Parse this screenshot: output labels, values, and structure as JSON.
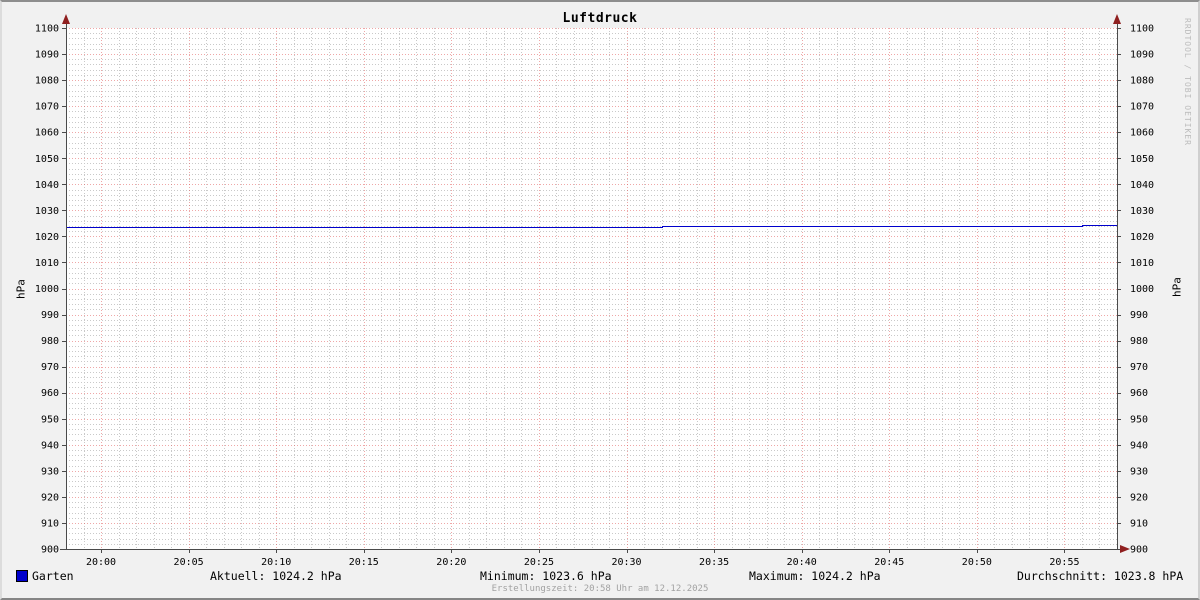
{
  "title": "Luftdruck",
  "watermark": "RRDTOOL / TOBI OETIKER",
  "axis_labels": {
    "left": "hPa",
    "right": "hPa"
  },
  "legend": {
    "series_label": "Garten",
    "aktuell": "Aktuell: 1024.2 hPa",
    "minimum": "Minimum: 1023.6 hPa",
    "maximum": "Maximum: 1024.2 hPa",
    "durchschnitt": "Durchschnitt: 1023.8 hPA"
  },
  "footer": "Erstellungszeit: 20:58 Uhr am 12.12.2025",
  "colors": {
    "background": "#f1f1f1",
    "canvas": "#ffffff",
    "major_grid": "#e05050",
    "minor_grid": "#c9c9c9",
    "axis": "#4a4a4a",
    "arrow": "#8f1f1f",
    "line": "#0000cc",
    "text": "#000000",
    "muted_text": "#a2a2a2",
    "watermark_text": "#bcbcbc"
  },
  "chart_data": {
    "type": "line",
    "title": "Luftdruck",
    "xlabel": "",
    "ylabel": "hPa",
    "grid": true,
    "x_range_minutes": [
      -2,
      58
    ],
    "ylim": [
      900,
      1100
    ],
    "y_tick_step": 10,
    "minor_x_step_minutes": 1,
    "minor_y_step": 2,
    "x_ticks": [
      {
        "min": 0,
        "label": "20:00"
      },
      {
        "min": 5,
        "label": "20:05"
      },
      {
        "min": 10,
        "label": "20:10"
      },
      {
        "min": 15,
        "label": "20:15"
      },
      {
        "min": 20,
        "label": "20:20"
      },
      {
        "min": 25,
        "label": "20:25"
      },
      {
        "min": 30,
        "label": "20:30"
      },
      {
        "min": 35,
        "label": "20:35"
      },
      {
        "min": 40,
        "label": "20:40"
      },
      {
        "min": 45,
        "label": "20:45"
      },
      {
        "min": 50,
        "label": "20:50"
      },
      {
        "min": 55,
        "label": "20:55"
      }
    ],
    "y_ticks": [
      900,
      910,
      920,
      930,
      940,
      950,
      960,
      970,
      980,
      990,
      1000,
      1010,
      1020,
      1030,
      1040,
      1050,
      1060,
      1070,
      1080,
      1090,
      1100
    ],
    "series": [
      {
        "name": "Garten",
        "color": "#0000cc",
        "points_min_hpa": [
          [
            -2,
            1023.6
          ],
          [
            32,
            1023.6
          ],
          [
            32,
            1024.0
          ],
          [
            56,
            1024.0
          ],
          [
            56,
            1024.2
          ],
          [
            58,
            1024.2
          ]
        ]
      }
    ],
    "stats": {
      "aktuell_hpa": 1024.2,
      "minimum_hpa": 1023.6,
      "maximum_hpa": 1024.2,
      "durchschnitt_hpa": 1023.8
    },
    "legend_position": "bottom"
  }
}
